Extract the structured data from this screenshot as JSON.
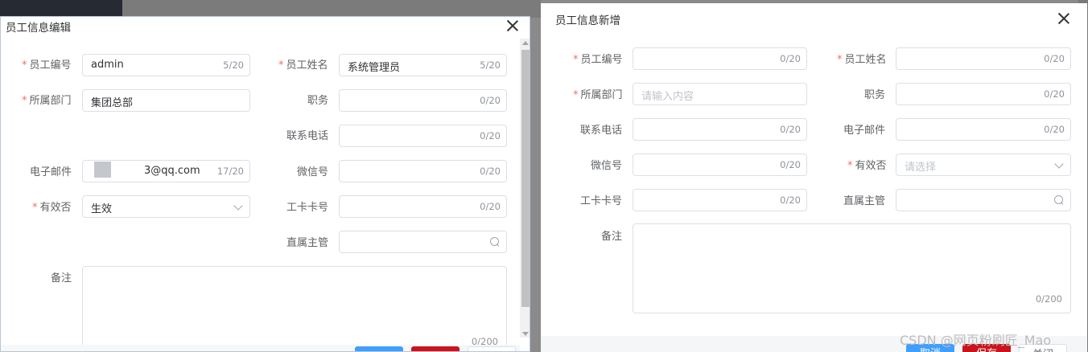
{
  "edit_dialog": {
    "title": "员工信息编辑",
    "fields": {
      "emp_no": {
        "label": "员工编号",
        "value": "admin",
        "count": "5/20"
      },
      "emp_name": {
        "label": "员工姓名",
        "value": "系统管理员",
        "count": "5/20"
      },
      "dept": {
        "label": "所属部门",
        "value": "集团总部"
      },
      "position": {
        "label": "职务",
        "count": "0/20"
      },
      "phone": {
        "label": "联系电话",
        "count": "0/20"
      },
      "email": {
        "label": "电子邮件",
        "value": "3@qq.com",
        "count": "17/20"
      },
      "wechat": {
        "label": "微信号",
        "count": "0/20"
      },
      "valid": {
        "label": "有效否",
        "value": "生效"
      },
      "card": {
        "label": "工卡卡号",
        "count": "0/20"
      },
      "manager": {
        "label": "直属主管"
      },
      "remark": {
        "label": "备注",
        "count": "0/200"
      }
    }
  },
  "add_dialog": {
    "title": "员工信息新增",
    "fields": {
      "emp_no": {
        "label": "员工编号",
        "count": "0/20"
      },
      "emp_name": {
        "label": "员工姓名",
        "count": "0/20"
      },
      "dept": {
        "label": "所属部门",
        "placeholder": "请输入内容"
      },
      "position": {
        "label": "职务",
        "count": "0/20"
      },
      "phone": {
        "label": "联系电话",
        "count": "0/20"
      },
      "email": {
        "label": "电子邮件",
        "count": "0/20"
      },
      "wechat": {
        "label": "微信号",
        "count": "0/20"
      },
      "valid": {
        "label": "有效否",
        "placeholder": "请选择"
      },
      "card": {
        "label": "工卡卡号",
        "count": "0/20"
      },
      "manager": {
        "label": "直属主管"
      },
      "remark": {
        "label": "备注",
        "count": "0/200"
      }
    },
    "buttons": {
      "cancel": "取消",
      "save": "保存",
      "close": "关闭"
    }
  },
  "required_mark": "*",
  "watermark": "CSDN @网页粉刷匠_Mao",
  "colors": {
    "primary": "#409eff",
    "danger": "#c9141d",
    "required": "#f56c6c"
  }
}
